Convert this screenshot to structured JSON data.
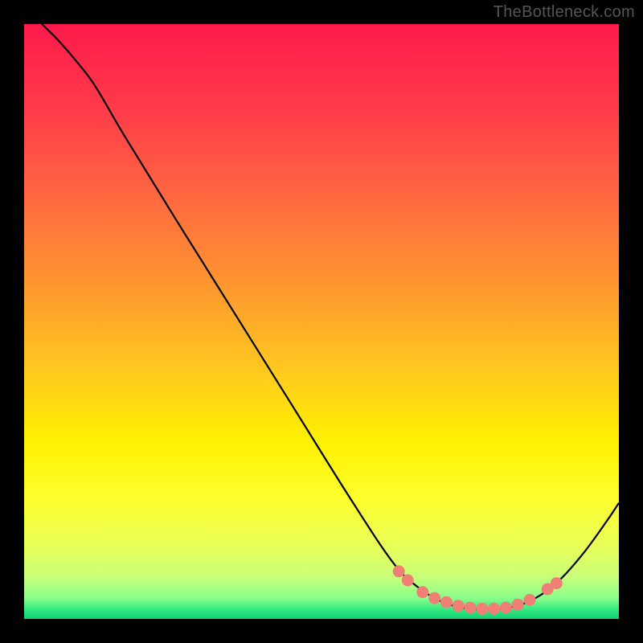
{
  "attribution": "TheBottleneck.com",
  "chart_data": {
    "type": "line",
    "title": "",
    "xlabel": "",
    "ylabel": "",
    "xlim": [
      0,
      100
    ],
    "ylim": [
      0,
      100
    ],
    "gradient_stops": [
      {
        "offset": 0.0,
        "color": "#ff1a4b"
      },
      {
        "offset": 0.15,
        "color": "#ff3d4a"
      },
      {
        "offset": 0.3,
        "color": "#ff6b3f"
      },
      {
        "offset": 0.45,
        "color": "#ff9a2e"
      },
      {
        "offset": 0.58,
        "color": "#ffc81f"
      },
      {
        "offset": 0.7,
        "color": "#fff100"
      },
      {
        "offset": 0.8,
        "color": "#fdff2e"
      },
      {
        "offset": 0.88,
        "color": "#e8ff5a"
      },
      {
        "offset": 0.93,
        "color": "#c8ff7a"
      },
      {
        "offset": 0.965,
        "color": "#8aff8a"
      },
      {
        "offset": 0.985,
        "color": "#30e880"
      },
      {
        "offset": 1.0,
        "color": "#10d070"
      }
    ],
    "series": [
      {
        "name": "bottleneck-curve",
        "points": [
          {
            "x": 3.0,
            "y": 100.0
          },
          {
            "x": 6.0,
            "y": 97.0
          },
          {
            "x": 9.0,
            "y": 93.5
          },
          {
            "x": 12.0,
            "y": 89.5
          },
          {
            "x": 17.0,
            "y": 81.0
          },
          {
            "x": 25.0,
            "y": 68.0
          },
          {
            "x": 35.0,
            "y": 52.0
          },
          {
            "x": 45.0,
            "y": 36.0
          },
          {
            "x": 55.0,
            "y": 20.0
          },
          {
            "x": 62.0,
            "y": 9.5
          },
          {
            "x": 66.0,
            "y": 5.5
          },
          {
            "x": 70.0,
            "y": 3.0
          },
          {
            "x": 74.0,
            "y": 1.8
          },
          {
            "x": 78.0,
            "y": 1.6
          },
          {
            "x": 82.0,
            "y": 2.0
          },
          {
            "x": 86.0,
            "y": 3.5
          },
          {
            "x": 90.0,
            "y": 6.5
          },
          {
            "x": 94.0,
            "y": 11.0
          },
          {
            "x": 98.0,
            "y": 16.5
          },
          {
            "x": 100.0,
            "y": 19.5
          }
        ]
      },
      {
        "name": "optimum-markers",
        "points": [
          {
            "x": 63.0,
            "y": 8.0
          },
          {
            "x": 64.5,
            "y": 6.5
          },
          {
            "x": 67.0,
            "y": 4.5
          },
          {
            "x": 69.0,
            "y": 3.5
          },
          {
            "x": 71.0,
            "y": 2.8
          },
          {
            "x": 73.0,
            "y": 2.2
          },
          {
            "x": 75.0,
            "y": 1.9
          },
          {
            "x": 77.0,
            "y": 1.7
          },
          {
            "x": 79.0,
            "y": 1.7
          },
          {
            "x": 81.0,
            "y": 1.9
          },
          {
            "x": 83.0,
            "y": 2.4
          },
          {
            "x": 85.0,
            "y": 3.2
          },
          {
            "x": 88.0,
            "y": 5.0
          },
          {
            "x": 89.5,
            "y": 6.0
          }
        ]
      }
    ],
    "marker_color": "#f08075",
    "curve_color": "#000000"
  }
}
